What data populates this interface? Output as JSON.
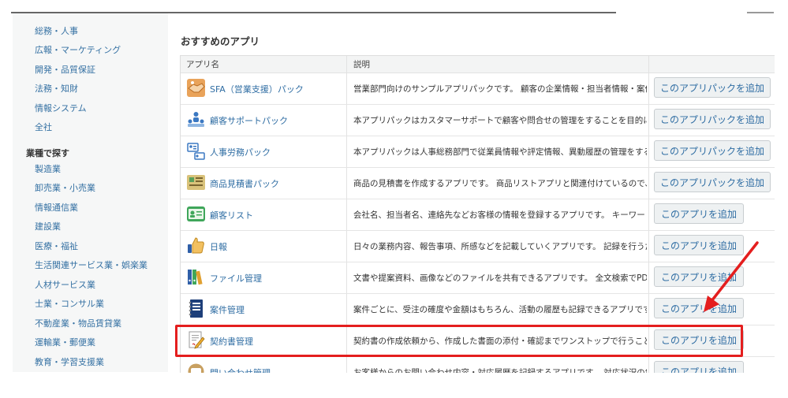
{
  "sidebar": {
    "dept_links": [
      "総務・人事",
      "広報・マーケティング",
      "開発・品質保証",
      "法務・知財",
      "情報システム",
      "全社"
    ],
    "industry_heading": "業種で探す",
    "industry_links": [
      "製造業",
      "卸売業・小売業",
      "情報通信業",
      "建設業",
      "医療・福祉",
      "生活関連サービス業・娯楽業",
      "人材サービス業",
      "士業・コンサル業",
      "不動産業・物品賃貸業",
      "運輸業・郵便業",
      "教育・学習支援業"
    ]
  },
  "main": {
    "section_title": "おすすめのアプリ",
    "columns": {
      "name": "アプリ名",
      "description": "説明"
    },
    "rows": [
      {
        "icon": "handshake-icon",
        "name": "SFA（営業支援）パック",
        "description": "営業部門向けのサンプルアプリパックです。 顧客の企業情報・担当者情報・案件…",
        "button": "このアプリパックを追加"
      },
      {
        "icon": "support-people-icon",
        "name": "顧客サポートパック",
        "description": "本アプリパックはカスタマーサポートで顧客や問合せの管理をすることを目的に…",
        "button": "このアプリパックを追加"
      },
      {
        "icon": "hr-id-card-icon",
        "name": "人事労務パック",
        "description": "本アプリパックは人事総務部門で従業員情報や評定情報、異動履歴の管理をする…",
        "button": "このアプリパックを追加"
      },
      {
        "icon": "estimate-document-icon",
        "name": "商品見積書パック",
        "description": "商品の見積書を作成するアプリです。 商品リストアプリと関連付けているので、…",
        "button": "このアプリパックを追加"
      },
      {
        "icon": "contact-card-icon",
        "name": "顧客リスト",
        "description": "会社名、担当者名、連絡先などお客様の情報を登録するアプリです。 キーワード…",
        "button": "このアプリを追加"
      },
      {
        "icon": "thumbs-up-icon",
        "name": "日報",
        "description": "日々の業務内容、報告事項、所感などを記載していくアプリです。 記録を行うだ…",
        "button": "このアプリを追加"
      },
      {
        "icon": "binders-icon",
        "name": "ファイル管理",
        "description": "文書や提案資料、画像などのファイルを共有できるアプリです。 全文検索でPDF…",
        "button": "このアプリを追加"
      },
      {
        "icon": "notebook-icon",
        "name": "案件管理",
        "description": "案件ごとに、受注の確度や金額はもちろん、活動の履歴も記録できるアプリです…",
        "button": "このアプリを追加"
      },
      {
        "icon": "contract-pencil-icon",
        "name": "契約書管理",
        "description": "契約書の作成依頼から、作成した書面の添付・確認までワンストップで行うこと…",
        "button": "このアプリを追加"
      },
      {
        "icon": "inquiry-icon",
        "name": "問い合わせ管理",
        "description": "お客様からのお問い合わせ内容・対応履歴を記録するアプリです。 対応状況の集…",
        "button": "このアプリを追加"
      }
    ]
  },
  "colors": {
    "highlight": "#e41e1e",
    "link": "#2f6da3",
    "sidebar_bg": "#f6f7f7"
  }
}
